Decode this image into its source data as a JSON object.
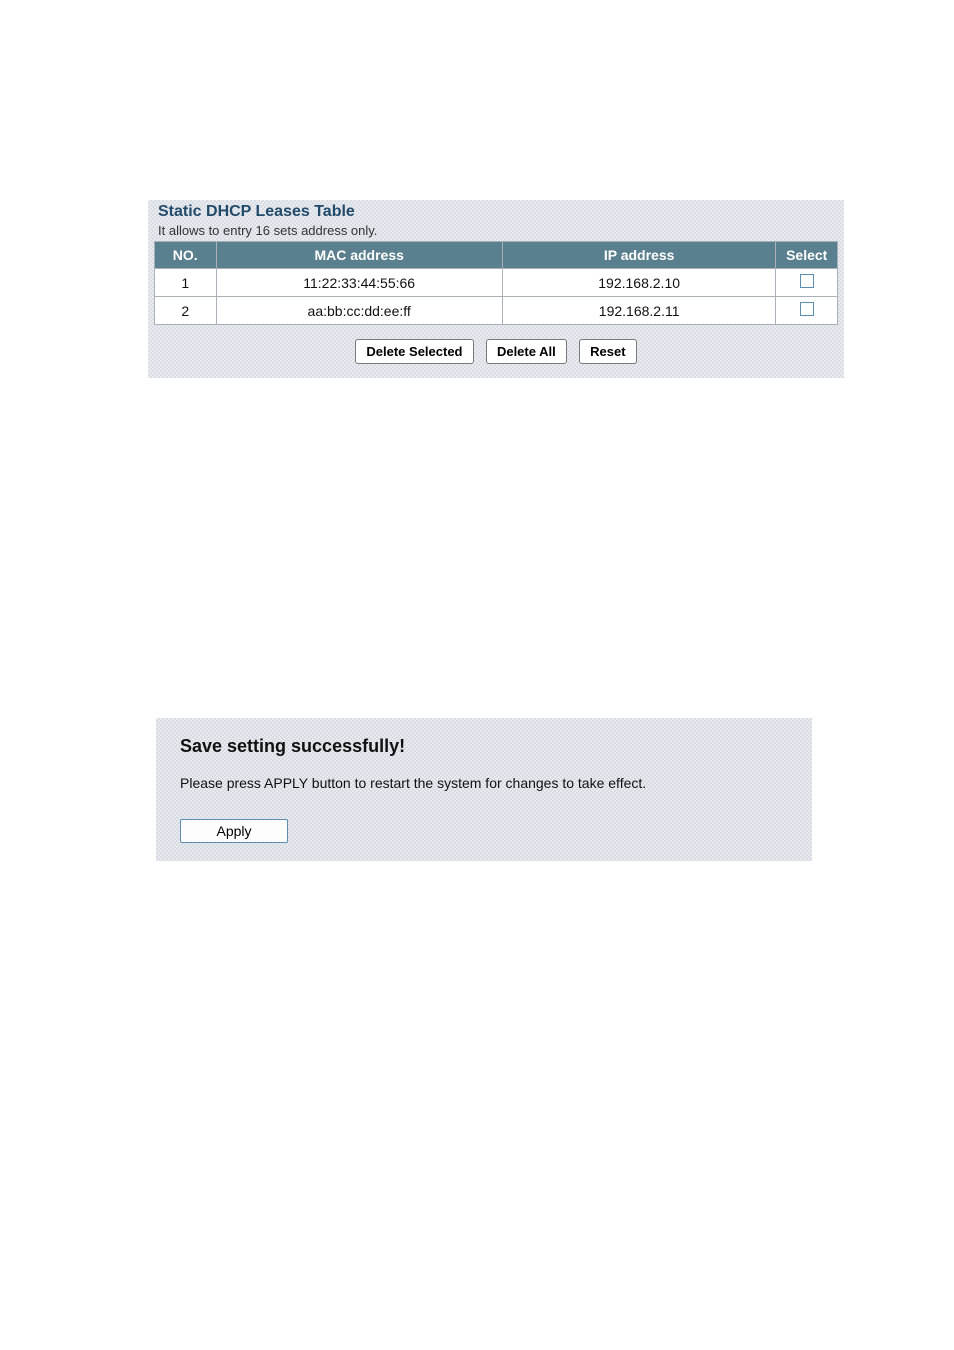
{
  "leases_panel": {
    "title": "Static DHCP Leases Table",
    "subtitle": "It allows to entry 16 sets address only.",
    "headers": {
      "no": "NO.",
      "mac": "MAC address",
      "ip": "IP address",
      "select": "Select"
    },
    "rows": [
      {
        "no": "1",
        "mac": "11:22:33:44:55:66",
        "ip": "192.168.2.10"
      },
      {
        "no": "2",
        "mac": "aa:bb:cc:dd:ee:ff",
        "ip": "192.168.2.11"
      }
    ],
    "buttons": {
      "delete_selected": "Delete Selected",
      "delete_all": "Delete All",
      "reset": "Reset"
    }
  },
  "save_panel": {
    "title": "Save setting successfully!",
    "message": "Please press APPLY button to restart the system for changes to take effect.",
    "apply_label": "Apply"
  }
}
